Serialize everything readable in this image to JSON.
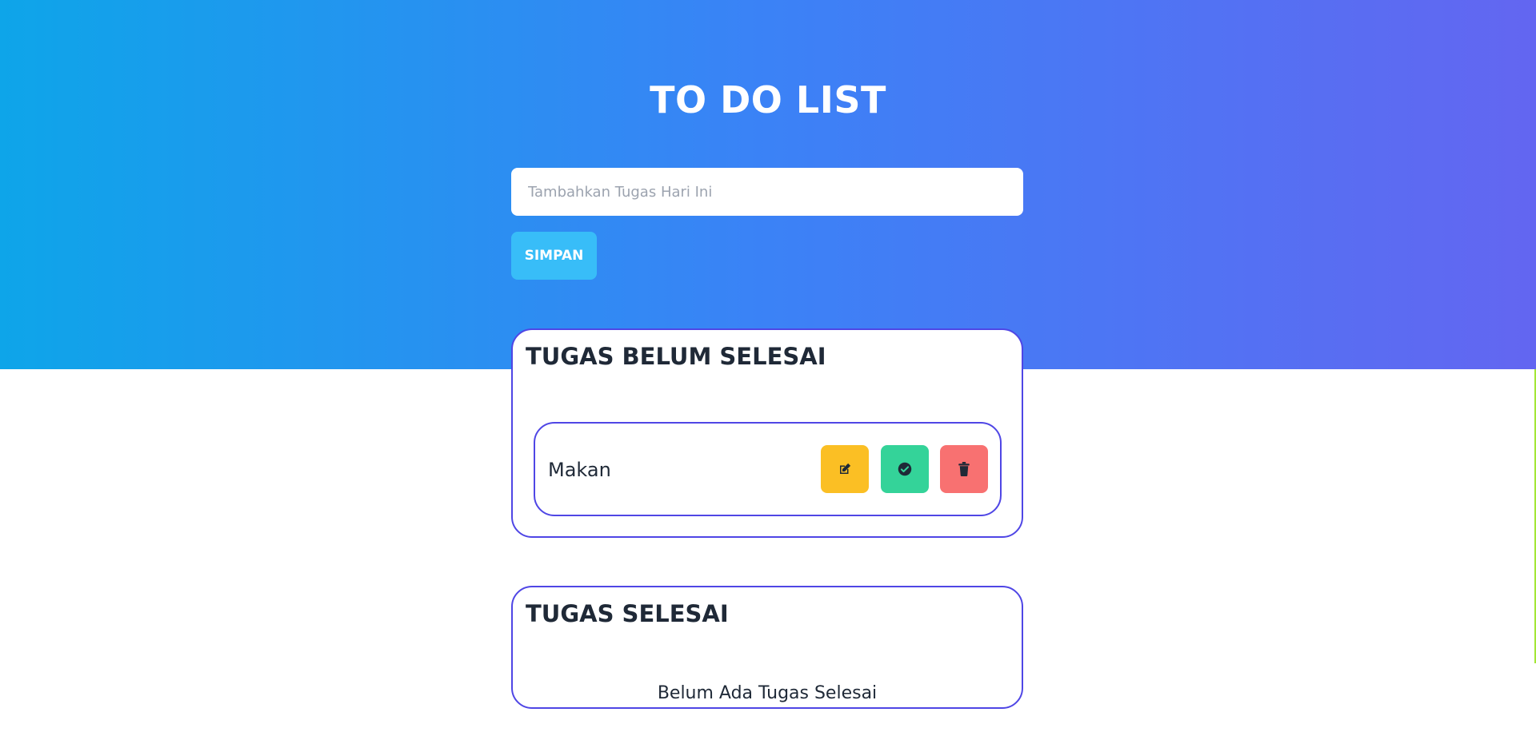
{
  "header": {
    "title": "TO DO LIST"
  },
  "form": {
    "placeholder": "Tambahkan Tugas Hari Ini",
    "value": "",
    "save_label": "SIMPAN"
  },
  "pending": {
    "title": "TUGAS BELUM SELESAI",
    "items": [
      {
        "label": "Makan",
        "actions": [
          "edit-icon",
          "check-circle-icon",
          "trash-icon"
        ]
      }
    ]
  },
  "done": {
    "title": "TUGAS SELESAI",
    "empty_text": "Belum Ada Tugas Selesai"
  },
  "colors": {
    "gradient_start": "#0ea5e9",
    "gradient_mid": "#3b82f6",
    "gradient_end": "#6366f1",
    "card_border": "#4f46e5",
    "save_button": "#38bdf8",
    "edit_button": "#fbbf24",
    "check_button": "#34d399",
    "delete_button": "#f87171"
  }
}
